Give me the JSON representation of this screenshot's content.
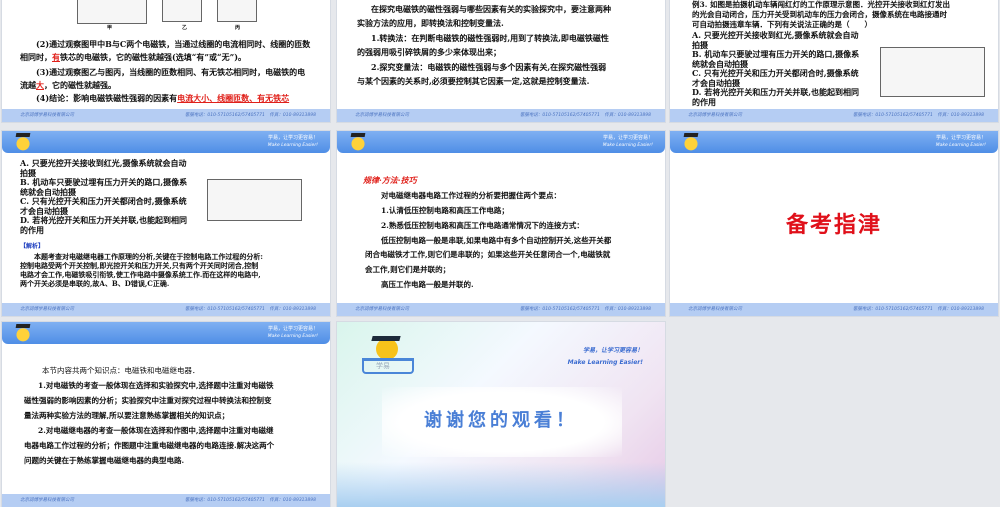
{
  "common": {
    "header_cn": "学易，让学习更容易！",
    "header_en": "Make Learning Easier!",
    "footer_company": "北京润博学易科技有限公司",
    "footer_contact": "客服电话：010-57105162/57405771　传真：010-89313898"
  },
  "slide1": {
    "fig_labels": [
      "甲",
      "乙",
      "丙"
    ],
    "l1": "(2)通过观察图甲中B与C两个电磁铁，当通过线圈的电流相同时、线圈的匝数",
    "l2a": "相同时，",
    "l2ans": "有",
    "l2b": "铁芯的电磁铁，它的磁性就越强(选填“有”或“无”)。",
    "l3": "(3)通过观察图乙与图丙，当线圈的匝数相同、有无铁芯相同时，电磁铁的电",
    "l4a": "流越",
    "l4ans": "大",
    "l4b": "，它的磁性就越强。",
    "l5a": "(4)结论：影响电磁铁磁性强弱的因素有",
    "l5ans": "电流大小、线圈匝数、有无铁芯"
  },
  "slide2": {
    "lines": [
      "在探究电磁铁的磁性强弱与哪些因素有关的实验探究中，要注意两种",
      "实验方法的应用，即转换法和控制变量法.",
      "1.转换法：在判断电磁铁的磁性强弱时,用到了转换法,即电磁铁磁性",
      "的强弱用吸引碎铁屑的多少来体现出来；",
      "2.探究变量法：电磁铁的磁性强弱与多个因素有关,在探究磁性强弱",
      "与某个因素的关系时,必须要控制其它因素一定,这就是控制变量法."
    ]
  },
  "slide3": {
    "q1": "例3. 如图是拍摄机动车辆闯红灯的工作原理示意图．光控开关接收到红灯发出",
    "q2": "的光会自动闭合，压力开关受到机动车的压力会闭合，摄像系统在电路接通时",
    "q3": "可自动拍摄违章车辆．下列有关说法正确的是（　　）",
    "options": [
      "A. 只要光控开关接收到红光,摄像系统就会自动拍摄",
      "B. 机动车只要驶过埋有压力开关的路口,摄像系统就会自动拍摄",
      "C. 只有光控开关和压力开关都闭合时,摄像系统才会自动拍摄",
      "D. 若将光控开关和压力开关并联,也能起到相同的作用"
    ]
  },
  "slide4": {
    "options": [
      "A. 只要光控开关接收到红光,摄像系统就会自动拍摄",
      "B. 机动车只要驶过埋有压力开关的路口,摄像系统就会自动拍摄",
      "C. 只有光控开关和压力开关都闭合时,摄像系统才会自动拍摄",
      "D. 若将光控开关和压力开关并联,也能起到相同的作用"
    ],
    "analysis_label": "【解析】",
    "analysis": [
      "　　本题考查对电磁继电器工作原理的分析,关键在于控制电路工作过程的分析:",
      "控制电路受两个开关控制,即光控开关和压力开关,只有两个开关同时闭合,控制",
      "电路才会工作,电磁铁吸引衔铁,使工作电路中摄像系统工作.而在这样的电路中,",
      "两个开关必须是串联的,故A、B、D错误,C正确."
    ]
  },
  "slide5": {
    "title": "规律·方法·技巧",
    "lines": [
      "对电磁继电器电路工作过程的分析要把握住两个要点：",
      "1.认清低压控制电路和高压工作电路；",
      "2.熟悉低压控制电路和高压工作电路通常情况下的连接方式：",
      "低压控制电路一般是串联,如果电路中有多个自动控制开关,这些开关都",
      "闭合电磁铁才工作,则它们是串联的；如果这些开关任意闭合一个,电磁铁就",
      "会工作,则它们是并联的；",
      "高压工作电路一般是并联的."
    ]
  },
  "slide6": {
    "title": "备考指津"
  },
  "slide7": {
    "lines": [
      "本节内容共两个知识点：电磁铁和电磁继电器．",
      "1.对电磁铁的考查一般体现在选择和实验探究中,选择题中注重对电磁铁",
      "磁性强弱的影响因素的分析；实验探究中注重对探究过程中转换法和控制变",
      "量法两种实验方法的理解,所以要注意熟练掌握相关的知识点；",
      "2.对电磁继电器的考查一般体现在选择和作图中,选择题中注重对电磁继",
      "电器电路工作过程的分析；作图题中注重电磁继电器的电路连接.解决这两个",
      "问题的关键在于熟练掌握电磁继电器的典型电路."
    ]
  },
  "slide8": {
    "title": "谢谢您的观看！",
    "logo_text": "学易"
  }
}
